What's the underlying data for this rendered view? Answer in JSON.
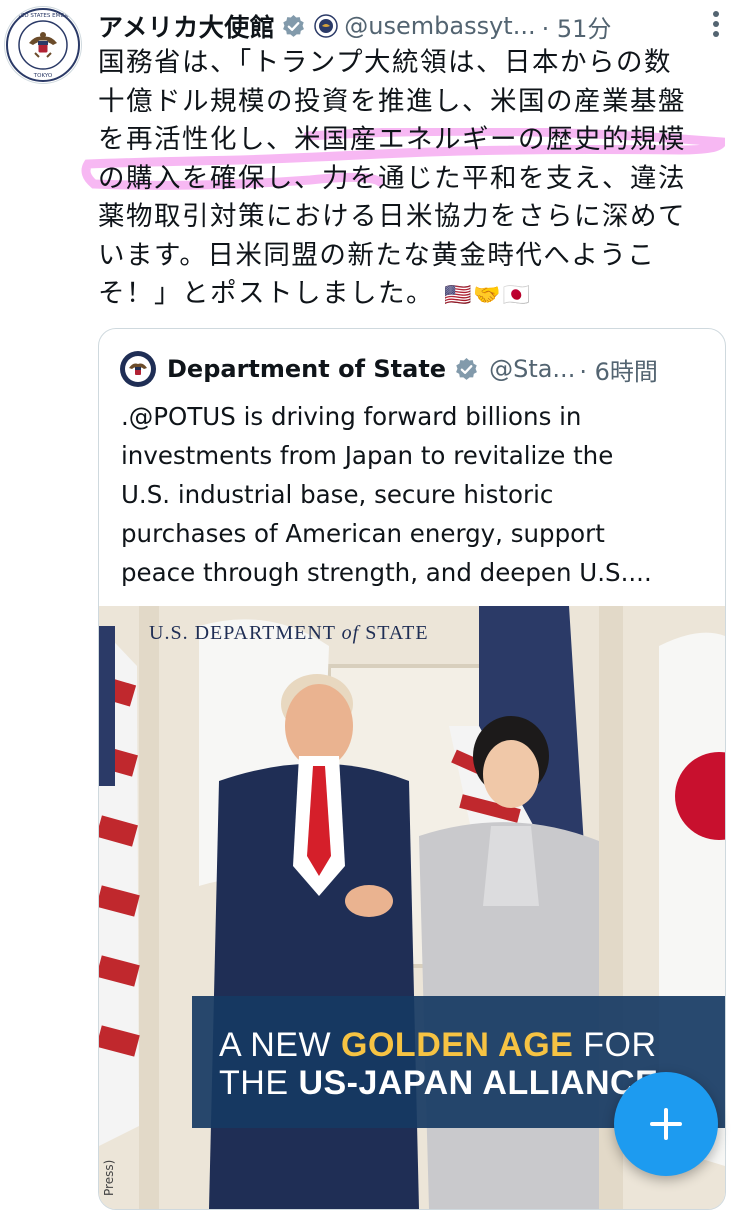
{
  "tweet": {
    "author_name": "アメリカ大使館",
    "handle": "@usembassyt...",
    "time": "· 51分",
    "text_lines": [
      "国務省は、「トランプ大統領は、日本からの数",
      "十億ドル規模の投資を推進し、米国の産業基盤",
      "を再活性化し、米国産エネルギーの歴史的規模",
      "の購入を確保し、力を通じた平和を支え、違法",
      "薬物取引対策における日米協力をさらに深めて",
      "います。日米同盟の新たな黄金時代へようこ",
      "そ！」とポストしました。"
    ],
    "emojis": "🇺🇸🤝🇯🇵",
    "avatar_seal_text": "UNITED STATES EMBASSY TOKYO"
  },
  "quote": {
    "author_name": "Department of State",
    "handle": "@Sta...",
    "time": "· 6時間",
    "text_lines": [
      ".@POTUS is driving forward billions in",
      "investments from Japan to revitalize the",
      "U.S. industrial base, secure historic",
      "purchases of American energy, support",
      "peace through strength, and deepen U.S...."
    ],
    "image": {
      "masthead_prefix": "U.S. DEPARTMENT",
      "masthead_of": "of",
      "masthead_suffix": "STATE",
      "banner_line1_pre": "A NEW ",
      "banner_line1_gold": "GOLDEN AGE",
      "banner_line1_post": " FOR",
      "banner_line2_pre": "THE ",
      "banner_line2_bold": "US-JAPAN ALLIANCE",
      "credit": "Press)"
    }
  },
  "colors": {
    "accent": "#1d9bf0",
    "highlight": "#f5a6f0",
    "gold": "#f6c343",
    "banner": "#163a63"
  }
}
